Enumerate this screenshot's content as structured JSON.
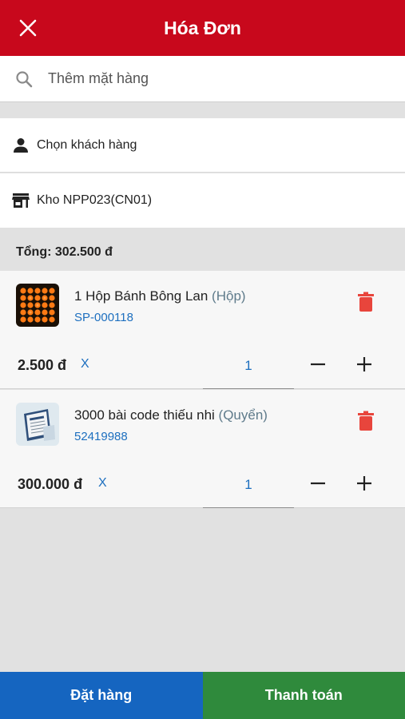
{
  "header": {
    "title": "Hóa Đơn",
    "close_icon": "close-icon"
  },
  "search": {
    "placeholder": "Thêm mặt hàng",
    "value": "",
    "icon": "search-icon"
  },
  "customer": {
    "label": "Chọn khách hàng",
    "icon": "person-icon"
  },
  "store": {
    "label": "Kho NPP023(CN01)",
    "icon": "store-icon"
  },
  "summary": {
    "total_label": "Tổng: 302.500 đ"
  },
  "items": [
    {
      "name": "1 Hộp Bánh Bông Lan",
      "unit": "(Hộp)",
      "code": "SP-000118",
      "price": "2.500 đ",
      "multiply": "X",
      "quantity": "1"
    },
    {
      "name": "3000 bài code thiếu nhi",
      "unit": "(Quyển)",
      "code": "52419988",
      "price": "300.000 đ",
      "multiply": "X",
      "quantity": "1"
    }
  ],
  "footer": {
    "order_label": "Đặt hàng",
    "pay_label": "Thanh toán"
  },
  "colors": {
    "header": "#c8081c",
    "link": "#1d6fbf",
    "trash": "#e8453c",
    "order": "#1565c0",
    "pay": "#2f8a3c"
  }
}
